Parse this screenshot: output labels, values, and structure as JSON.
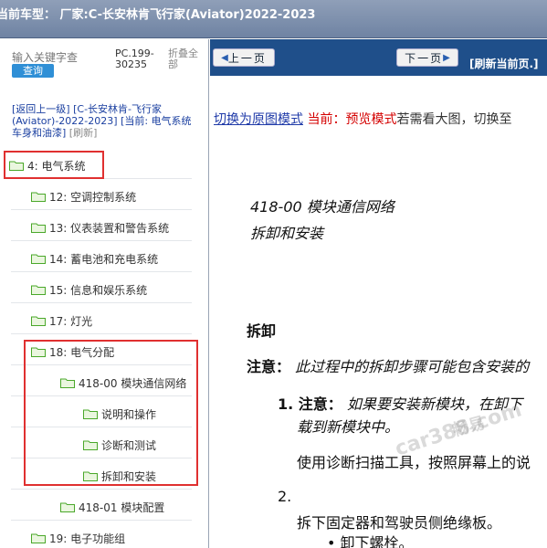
{
  "window": {
    "title": "当前车型： 厂家:C-长安林肯飞行家(Aviator)2022-2023"
  },
  "sidebar": {
    "search_placeholder": "输入关键字查",
    "search_button": "查询",
    "pc_label": "PC.199-30235",
    "collapse_label": "折叠全部",
    "breadcrumb_back": "[返回上一级]",
    "breadcrumb_model": "[C-长安林肯-飞行家(Aviator)-2022-2023]",
    "breadcrumb_current": "[当前: 电气系统 车身和油漆]",
    "breadcrumb_refresh": "[刷新]",
    "tree": [
      {
        "label": "4: 电气系统"
      },
      {
        "label": "12: 空调控制系统"
      },
      {
        "label": "13: 仪表装置和警告系统"
      },
      {
        "label": "14: 蓄电池和充电系统"
      },
      {
        "label": "15: 信息和娱乐系统"
      },
      {
        "label": "17: 灯光"
      },
      {
        "label": "18: 电气分配"
      },
      {
        "label": "418-00 模块通信网络"
      },
      {
        "label": "说明和操作"
      },
      {
        "label": "诊断和测试"
      },
      {
        "label": "拆卸和安装"
      },
      {
        "label": "418-01 模块配置"
      },
      {
        "label": "19: 电子功能组"
      }
    ]
  },
  "viewer": {
    "prev_button": "上一页",
    "next_button": "下一页",
    "refresh_label": "[刷新当前页.]",
    "mode_switch": "切换为原图模式",
    "mode_current": "当前：预览模式",
    "mode_hint": "若需看大图，切换至",
    "doc_title_1": "418-00 模块通信网络",
    "doc_title_2": "拆卸和安装",
    "section_heading": "拆卸",
    "note_label": "注意：",
    "note_text": "此过程中的拆卸步骤可能包含安装的",
    "step1_label": "1. 注意：",
    "step1_text": "如果要安装新模块，在卸下",
    "step1_cont": "载到新模块中。",
    "step1_para": "使用诊断扫描工具，按照屏幕上的说",
    "step2_label": "2.",
    "step2_para": "拆下固定器和驾驶员侧绝缘板。",
    "bullet_1": "卸下螺栓。",
    "watermark_1": "畅易",
    "watermark_2": "car388.com"
  },
  "colors": {
    "nav_bar": "#1f4f8a",
    "highlight_box": "#e03030",
    "folder": "#7cc24a",
    "link": "#1f3aa8",
    "current": "#d40000"
  }
}
